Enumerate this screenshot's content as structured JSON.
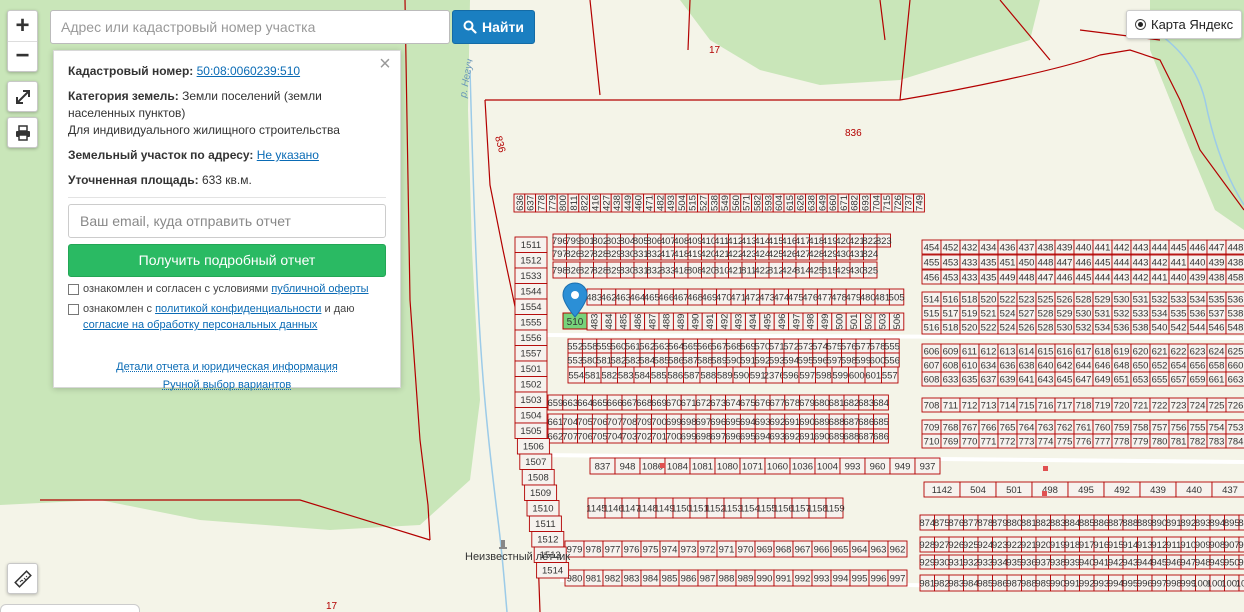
{
  "search": {
    "placeholder": "Адрес или кадастровый номер участка",
    "button_label": "Найти"
  },
  "zoom": {
    "in_label": "+",
    "out_label": "−"
  },
  "layer": {
    "label": "Карта Яндекс"
  },
  "info_panel": {
    "cadastral_label": "Кадастровый номер:",
    "cadastral_value": "50:08:0060239:510",
    "land_category_label": "Категория земель:",
    "land_category_value": "Земли поселений (земли населенных пунктов)",
    "permitted_use": "Для индивидуального жилищного строительства",
    "address_label": "Земельный участок по адресу:",
    "address_value": "Не указано",
    "area_label": "Уточненная площадь:",
    "area_value": "633 кв.м.",
    "email_placeholder": "Ваш email, куда отправить отчет",
    "report_button": "Получить подробный отчет",
    "offer_consent_prefix": "ознакомлен и согласен с условиями",
    "offer_consent_link": "публичной оферты",
    "privacy_prefix": "ознакомлен с",
    "privacy_link": "политикой конфиденциальности",
    "privacy_middle": "и даю",
    "personal_data_link": "согласие на обработку персональных данных",
    "details_link": "Детали отчета и юридическая информация",
    "manual_link": "Ручной выбор вариантов"
  },
  "map": {
    "selected_parcel": "510",
    "road_labels": [
      "17",
      "836",
      "836",
      "17"
    ],
    "river_label": "р. Негуч",
    "poi_label": "Неизвестный лётчик",
    "colors": {
      "forest": "#c9e6b9",
      "field": "#f4f4e8",
      "boundary": "#b30000",
      "selected": "#76d37a",
      "marker": "#2b8fd6"
    },
    "parcels": {
      "row_a": [
        "636",
        "637",
        "778",
        "779",
        "800",
        "811",
        "822",
        "416",
        "427",
        "438",
        "449",
        "460",
        "471",
        "482",
        "493",
        "504",
        "515",
        "527",
        "538",
        "549",
        "560",
        "571",
        "582",
        "593",
        "604",
        "615",
        "626",
        "638",
        "649",
        "660",
        "671",
        "682",
        "693",
        "704",
        "715",
        "726",
        "737",
        "749"
      ],
      "row_b": [
        "796",
        "799",
        "801",
        "802",
        "803",
        "804",
        "805",
        "806",
        "407",
        "408",
        "409",
        "410",
        "411",
        "412",
        "413",
        "414",
        "415",
        "416",
        "417",
        "418",
        "419",
        "420",
        "421",
        "822",
        "823"
      ],
      "row_c": [
        "797",
        "826",
        "827",
        "828",
        "829",
        "830",
        "831",
        "832",
        "417",
        "418",
        "419",
        "420",
        "421",
        "422",
        "423",
        "424",
        "425",
        "426",
        "427",
        "428",
        "429",
        "430",
        "431",
        "824"
      ],
      "row_d": [
        "798",
        "826",
        "827",
        "828",
        "829",
        "830",
        "831",
        "832",
        "833",
        "418",
        "808",
        "420",
        "810",
        "421",
        "811",
        "422",
        "812",
        "424",
        "814",
        "425",
        "815",
        "429",
        "430",
        "825"
      ],
      "row_e": [
        "483",
        "462",
        "463",
        "464",
        "465",
        "466",
        "467",
        "468",
        "469",
        "470",
        "471",
        "472",
        "473",
        "474",
        "475",
        "476",
        "477",
        "478",
        "479",
        "480",
        "481",
        "505"
      ],
      "row_f": [
        "483",
        "484",
        "485",
        "486",
        "487",
        "488",
        "489",
        "490",
        "491",
        "492",
        "493",
        "494",
        "495",
        "496",
        "497",
        "498",
        "499",
        "500",
        "501",
        "502",
        "503",
        "506"
      ],
      "row_g": [
        "552",
        "558",
        "559",
        "560",
        "561",
        "562",
        "563",
        "564",
        "565",
        "566",
        "567",
        "568",
        "569",
        "570",
        "571",
        "572",
        "573",
        "574",
        "575",
        "576",
        "577",
        "578",
        "555"
      ],
      "row_h": [
        "553",
        "580",
        "581",
        "582",
        "583",
        "584",
        "585",
        "586",
        "587",
        "588",
        "589",
        "590",
        "591",
        "592",
        "593",
        "594",
        "595",
        "596",
        "597",
        "598",
        "599",
        "600",
        "556"
      ],
      "row_i": [
        "554",
        "581",
        "582",
        "583",
        "584",
        "585",
        "586",
        "587",
        "588",
        "589",
        "590",
        "591",
        "2376",
        "596",
        "597",
        "598",
        "599",
        "600",
        "601",
        "557"
      ],
      "row_j": [
        "659",
        "663",
        "664",
        "665",
        "666",
        "667",
        "668",
        "669",
        "670",
        "671",
        "672",
        "673",
        "674",
        "675",
        "676",
        "677",
        "678",
        "679",
        "680",
        "681",
        "682",
        "683",
        "684"
      ],
      "row_k": [
        "661",
        "704",
        "705",
        "706",
        "707",
        "708",
        "709",
        "700",
        "699",
        "698",
        "697",
        "696",
        "695",
        "694",
        "693",
        "692",
        "691",
        "690",
        "689",
        "688",
        "687",
        "686",
        "685"
      ],
      "row_l": [
        "662",
        "707",
        "706",
        "705",
        "704",
        "703",
        "702",
        "701",
        "700",
        "699",
        "698",
        "697",
        "696",
        "695",
        "694",
        "693",
        "692",
        "691",
        "690",
        "689",
        "688",
        "687",
        "686"
      ],
      "east_a": [
        "454",
        "452",
        "432",
        "434",
        "436",
        "437",
        "438",
        "439",
        "440",
        "441",
        "442",
        "443",
        "444",
        "445",
        "446",
        "447",
        "448"
      ],
      "east_b": [
        "455",
        "453",
        "433",
        "435",
        "451",
        "450",
        "448",
        "447",
        "446",
        "445",
        "444",
        "443",
        "442",
        "441",
        "440",
        "439",
        "438"
      ],
      "east_c": [
        "456",
        "453",
        "433",
        "435",
        "449",
        "448",
        "447",
        "446",
        "445",
        "444",
        "443",
        "442",
        "441",
        "440",
        "439",
        "438",
        "458"
      ],
      "east_d": [
        "514",
        "516",
        "518",
        "520",
        "522",
        "523",
        "525",
        "526",
        "528",
        "529",
        "530",
        "531",
        "532",
        "533",
        "534",
        "535",
        "536"
      ],
      "east_e": [
        "515",
        "517",
        "519",
        "521",
        "524",
        "527",
        "528",
        "529",
        "530",
        "531",
        "532",
        "533",
        "534",
        "535",
        "536",
        "537",
        "538"
      ],
      "east_f": [
        "516",
        "518",
        "520",
        "522",
        "524",
        "526",
        "528",
        "530",
        "532",
        "534",
        "536",
        "538",
        "540",
        "542",
        "544",
        "546",
        "548"
      ],
      "east_g": [
        "606",
        "609",
        "611",
        "612",
        "613",
        "614",
        "615",
        "616",
        "617",
        "618",
        "619",
        "620",
        "621",
        "622",
        "623",
        "624",
        "625"
      ],
      "east_h": [
        "607",
        "608",
        "610",
        "634",
        "636",
        "638",
        "640",
        "642",
        "644",
        "646",
        "648",
        "650",
        "652",
        "654",
        "656",
        "658",
        "660"
      ],
      "east_i": [
        "608",
        "633",
        "635",
        "637",
        "639",
        "641",
        "643",
        "645",
        "647",
        "649",
        "651",
        "653",
        "655",
        "657",
        "659",
        "661",
        "663"
      ],
      "east_j": [
        "708",
        "711",
        "712",
        "713",
        "714",
        "715",
        "716",
        "717",
        "718",
        "719",
        "720",
        "721",
        "722",
        "723",
        "724",
        "725",
        "726"
      ],
      "east_k": [
        "709",
        "768",
        "767",
        "766",
        "765",
        "764",
        "763",
        "762",
        "761",
        "760",
        "759",
        "758",
        "757",
        "756",
        "755",
        "754",
        "753"
      ],
      "east_l": [
        "710",
        "769",
        "770",
        "771",
        "772",
        "773",
        "774",
        "775",
        "776",
        "777",
        "778",
        "779",
        "780",
        "781",
        "782",
        "783",
        "784"
      ],
      "west_col": [
        "1511",
        "1512",
        "1533",
        "1544",
        "1554",
        "1555",
        "1556",
        "1557",
        "1501",
        "1502",
        "1503",
        "1504",
        "1505",
        "1506",
        "1507",
        "1508",
        "1509",
        "1510",
        "1511",
        "1512",
        "1513",
        "1514"
      ],
      "south_a": [
        "837",
        "948",
        "1086",
        "1084",
        "1081",
        "1080",
        "1071",
        "1060",
        "1036",
        "1004",
        "993",
        "960",
        "949",
        "937"
      ],
      "south_b": [
        "1145",
        "1146",
        "1147",
        "1148",
        "1149",
        "1150",
        "1151",
        "1152",
        "1153",
        "1154",
        "1155",
        "1156",
        "1157",
        "1158",
        "1159"
      ],
      "south_c": [
        "979",
        "978",
        "977",
        "976",
        "975",
        "974",
        "973",
        "972",
        "971",
        "970",
        "969",
        "968",
        "967",
        "966",
        "965",
        "964",
        "963",
        "962"
      ],
      "south_d": [
        "980",
        "981",
        "982",
        "983",
        "984",
        "985",
        "986",
        "987",
        "988",
        "989",
        "990",
        "991",
        "992",
        "993",
        "994",
        "995",
        "996",
        "997"
      ],
      "south_e": [
        "874",
        "875",
        "876",
        "877",
        "878",
        "879",
        "880",
        "881",
        "882",
        "883",
        "884",
        "885",
        "886",
        "887",
        "888",
        "889",
        "890",
        "891",
        "892",
        "893",
        "894",
        "895",
        "896"
      ],
      "south_f": [
        "928",
        "927",
        "926",
        "925",
        "924",
        "923",
        "922",
        "921",
        "920",
        "919",
        "918",
        "917",
        "916",
        "915",
        "914",
        "913",
        "912",
        "911",
        "910",
        "909",
        "908",
        "907",
        "906"
      ],
      "south_g": [
        "929",
        "930",
        "931",
        "932",
        "933",
        "934",
        "935",
        "936",
        "937",
        "938",
        "939",
        "940",
        "941",
        "942",
        "943",
        "944",
        "945",
        "946",
        "947",
        "948",
        "949",
        "950",
        "951"
      ],
      "south_h": [
        "981",
        "982",
        "983",
        "984",
        "985",
        "986",
        "987",
        "988",
        "989",
        "990",
        "991",
        "992",
        "993",
        "994",
        "995",
        "996",
        "997",
        "998",
        "999",
        "1000",
        "1001",
        "1002",
        "1003"
      ],
      "mid_road": [
        "1142",
        "504",
        "501",
        "498",
        "495",
        "492",
        "439",
        "440",
        "437"
      ]
    }
  }
}
